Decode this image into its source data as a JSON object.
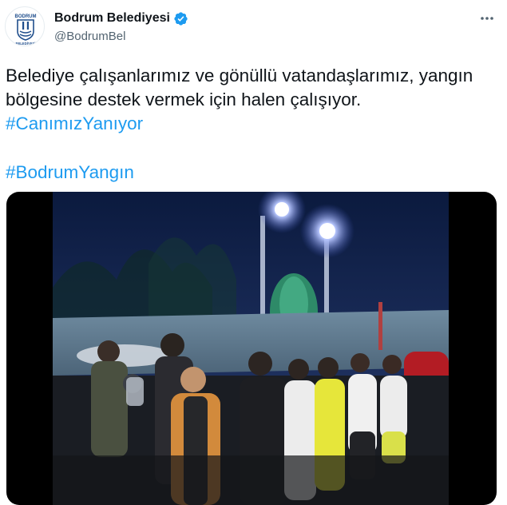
{
  "account": {
    "name": "Bodrum Belediyesi",
    "handle": "@BodrumBel",
    "logo_text_top": "BODRUM",
    "logo_text_bottom": "BELEDİYESİ"
  },
  "tweet": {
    "line1": "Belediye çalışanlarımız ve gönüllü vatandaşlarımız, yangın",
    "line2": "bölgesine destek vermek için halen çalışıyor.",
    "hashtag1": "#CanımızYanıyor",
    "hashtag2": "#BodrumYangın"
  },
  "icons": {
    "verified": "verified-badge-icon",
    "more": "more-options-icon"
  },
  "colors": {
    "accent": "#1d9bf0",
    "logo": "#1f4e8c",
    "text": "#0f1419",
    "secondary": "#536471"
  }
}
